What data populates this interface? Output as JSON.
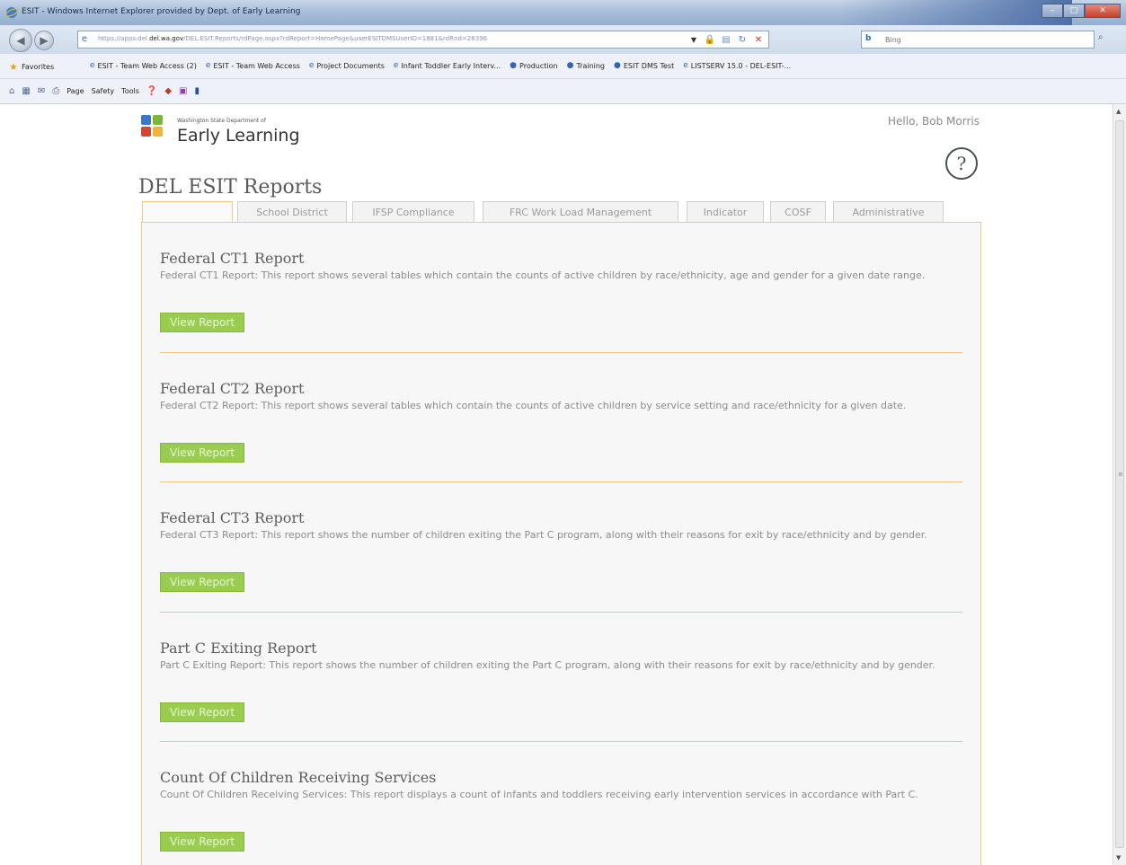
{
  "browser": {
    "title": "ESIT - Windows Internet Explorer provided by Dept. of Early Learning",
    "url_prefix": "https://apps.del.",
    "url_host": "del.wa.gov",
    "url_path": "/DEL.ESIT.Reports/rdPage.aspx?rdReport=HomePage&userESITDMSUserID=1881&rdRnd=28396",
    "search_placeholder": "Bing",
    "favorites_label": "Favorites",
    "favorites": [
      "ESIT - Team Web Access (2)",
      "ESIT - Team Web Access",
      "Project Documents",
      "Infant Toddler Early Interv...",
      "Production",
      "Training",
      "ESIT DMS Test",
      "LISTSERV 15.0 - DEL-ESIT-..."
    ],
    "commands": {
      "page": "Page",
      "safety": "Safety",
      "tools": "Tools"
    }
  },
  "header": {
    "department": "Washington State Department of",
    "brand": "Early Learning",
    "greeting": "Hello, Bob Morris"
  },
  "page": {
    "heading": "DEL ESIT Reports"
  },
  "tabs": [
    {
      "label": ""
    },
    {
      "label": "School District"
    },
    {
      "label": "IFSP Compliance"
    },
    {
      "label": "FRC Work Load Management"
    },
    {
      "label": "Indicator"
    },
    {
      "label": "COSF"
    },
    {
      "label": "Administrative"
    }
  ],
  "reports": [
    {
      "title": "Federal CT1 Report",
      "description": "Federal CT1 Report: This report shows several tables which contain the counts of active children by race/ethnicity, age and gender for a given date range.",
      "button": "View Report"
    },
    {
      "title": "Federal CT2 Report",
      "description": "Federal CT2 Report: This report shows several tables which contain the counts of active children by service setting and race/ethnicity for a given date.",
      "button": "View Report"
    },
    {
      "title": "Federal CT3 Report",
      "description": "Federal CT3 Report: This report shows the number of children exiting the Part C program, along with their reasons for exit by race/ethnicity and by gender.",
      "button": "View Report"
    },
    {
      "title": "Part C Exiting Report",
      "description": "Part C Exiting Report: This report shows the number of children exiting the Part C program, along with their reasons for exit by race/ethnicity and by gender.",
      "button": "View Report"
    },
    {
      "title": "Count Of Children Receiving Services",
      "description": "Count Of Children Receiving Services: This report displays a count of infants and toddlers receiving early intervention services in accordance with Part C.",
      "button": "View Report"
    }
  ],
  "colors": {
    "button": "#9acd4f",
    "divider": "#f1c58a",
    "panel_border": "#f0c98a"
  }
}
